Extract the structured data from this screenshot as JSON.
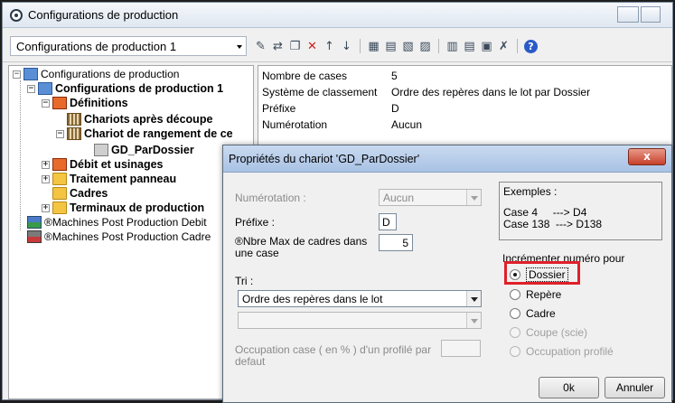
{
  "window": {
    "title": "Configurations de production"
  },
  "toolbar": {
    "config_combo": "Configurations de production 1"
  },
  "tree": {
    "items": [
      {
        "label": "Configurations de production"
      },
      {
        "label": "Configurations de production 1"
      },
      {
        "label": "Définitions"
      },
      {
        "label": "Chariots après découpe"
      },
      {
        "label": "Chariot de rangement de ce"
      },
      {
        "label": "GD_ParDossier"
      },
      {
        "label": "Débit et usinages"
      },
      {
        "label": "Traitement panneau"
      },
      {
        "label": "Cadres"
      },
      {
        "label": "Terminaux de production"
      },
      {
        "label": "®Machines Post Production Debit"
      },
      {
        "label": "®Machines Post Production Cadre"
      }
    ]
  },
  "properties": {
    "rows": [
      {
        "label": "Nombre de cases",
        "value": "5"
      },
      {
        "label": "Système de classement",
        "value": "Ordre des repères dans le lot par Dossier"
      },
      {
        "label": "Préfixe",
        "value": "D"
      },
      {
        "label": "Numérotation",
        "value": "Aucun"
      }
    ]
  },
  "dialog": {
    "title": "Propriétés du chariot 'GD_ParDossier'",
    "close": "x",
    "numerotation_label": "Numérotation :",
    "numerotation_value": "Aucun",
    "prefixe_label": "Préfixe :",
    "prefixe_value": "D",
    "max_cadres_label_line1": "®Nbre Max de cadres dans",
    "max_cadres_label_line2": "une case",
    "max_cadres_value": "5",
    "tri_label": "Tri :",
    "tri_value": "Ordre des repères dans le lot",
    "tri2_value": "",
    "occupation_label_line1": "Occupation case ( en % ) d'un profilé par",
    "occupation_label_line2": "defaut",
    "occupation_value": "",
    "examples": {
      "title": "Exemples :",
      "line1": "Case 4     ---> D4",
      "line2": "Case 138  ---> D138"
    },
    "increment_label": "Incrémenter numéro pour",
    "radios": [
      {
        "label": "Dossier",
        "checked": true,
        "enabled": true
      },
      {
        "label": "Repère",
        "checked": false,
        "enabled": true
      },
      {
        "label": "Cadre",
        "checked": false,
        "enabled": true
      },
      {
        "label": "Coupe (scie)",
        "checked": false,
        "enabled": false
      },
      {
        "label": "Occupation profilé",
        "checked": false,
        "enabled": false
      }
    ],
    "ok_label": "0k",
    "cancel_label": "Annuler"
  },
  "colors": {
    "highlight": "#e0202a",
    "dialog_title": "#b9cfea",
    "close_button": "#c8402a"
  }
}
